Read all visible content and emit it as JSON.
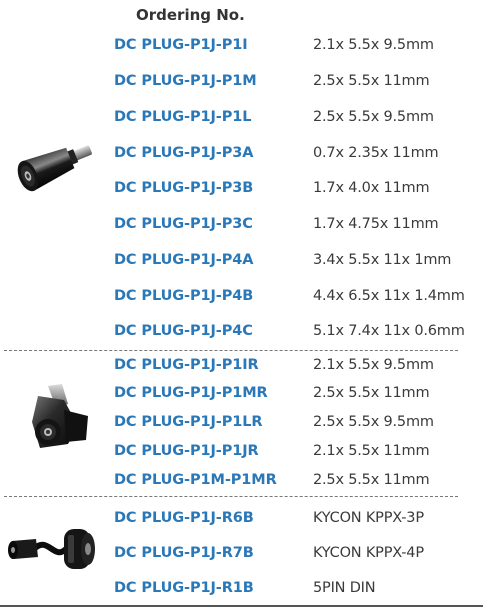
{
  "header": {
    "title": "Ordering No."
  },
  "groups": [
    {
      "image": "straight-dc-plug-adapter",
      "rows": [
        {
          "code": "DC PLUG-P1J-P1I",
          "spec": "2.1x 5.5x 9.5mm"
        },
        {
          "code": "DC PLUG-P1J-P1M",
          "spec": "2.5x 5.5x 11mm"
        },
        {
          "code": "DC PLUG-P1J-P1L",
          "spec": "2.5x 5.5x 9.5mm"
        },
        {
          "code": "DC PLUG-P1J-P3A",
          "spec": "0.7x 2.35x 11mm"
        },
        {
          "code": "DC PLUG-P1J-P3B",
          "spec": "1.7x 4.0x 11mm"
        },
        {
          "code": "DC PLUG-P1J-P3C",
          "spec": "1.7x 4.75x 11mm"
        },
        {
          "code": "DC PLUG-P1J-P4A",
          "spec": "3.4x 5.5x 11x 1mm"
        },
        {
          "code": "DC PLUG-P1J-P4B",
          "spec": "4.4x 6.5x 11x 1.4mm"
        },
        {
          "code": "DC PLUG-P1J-P4C",
          "spec": "5.1x 7.4x 11x 0.6mm"
        }
      ]
    },
    {
      "image": "right-angle-dc-plug-adapter",
      "rows": [
        {
          "code": "DC PLUG-P1J-P1IR",
          "spec": "2.1x 5.5x 9.5mm"
        },
        {
          "code": "DC PLUG-P1J-P1MR",
          "spec": "2.5x 5.5x 11mm"
        },
        {
          "code": "DC PLUG-P1J-P1LR",
          "spec": "2.5x 5.5x 9.5mm"
        },
        {
          "code": "DC PLUG-P1J-P1JR",
          "spec": "2.1x 5.5x 11mm"
        },
        {
          "code": "DC PLUG-P1M-P1MR",
          "spec": "2.5x 5.5x 11mm"
        }
      ]
    },
    {
      "image": "dc-jack-to-din-cable-adapter",
      "rows": [
        {
          "code": "DC PLUG-P1J-R6B",
          "spec": "KYCON KPPX-3P"
        },
        {
          "code": "DC PLUG-P1J-R7B",
          "spec": "KYCON KPPX-4P"
        },
        {
          "code": "DC PLUG-P1J-R1B",
          "spec": "5PIN DIN"
        }
      ]
    }
  ]
}
